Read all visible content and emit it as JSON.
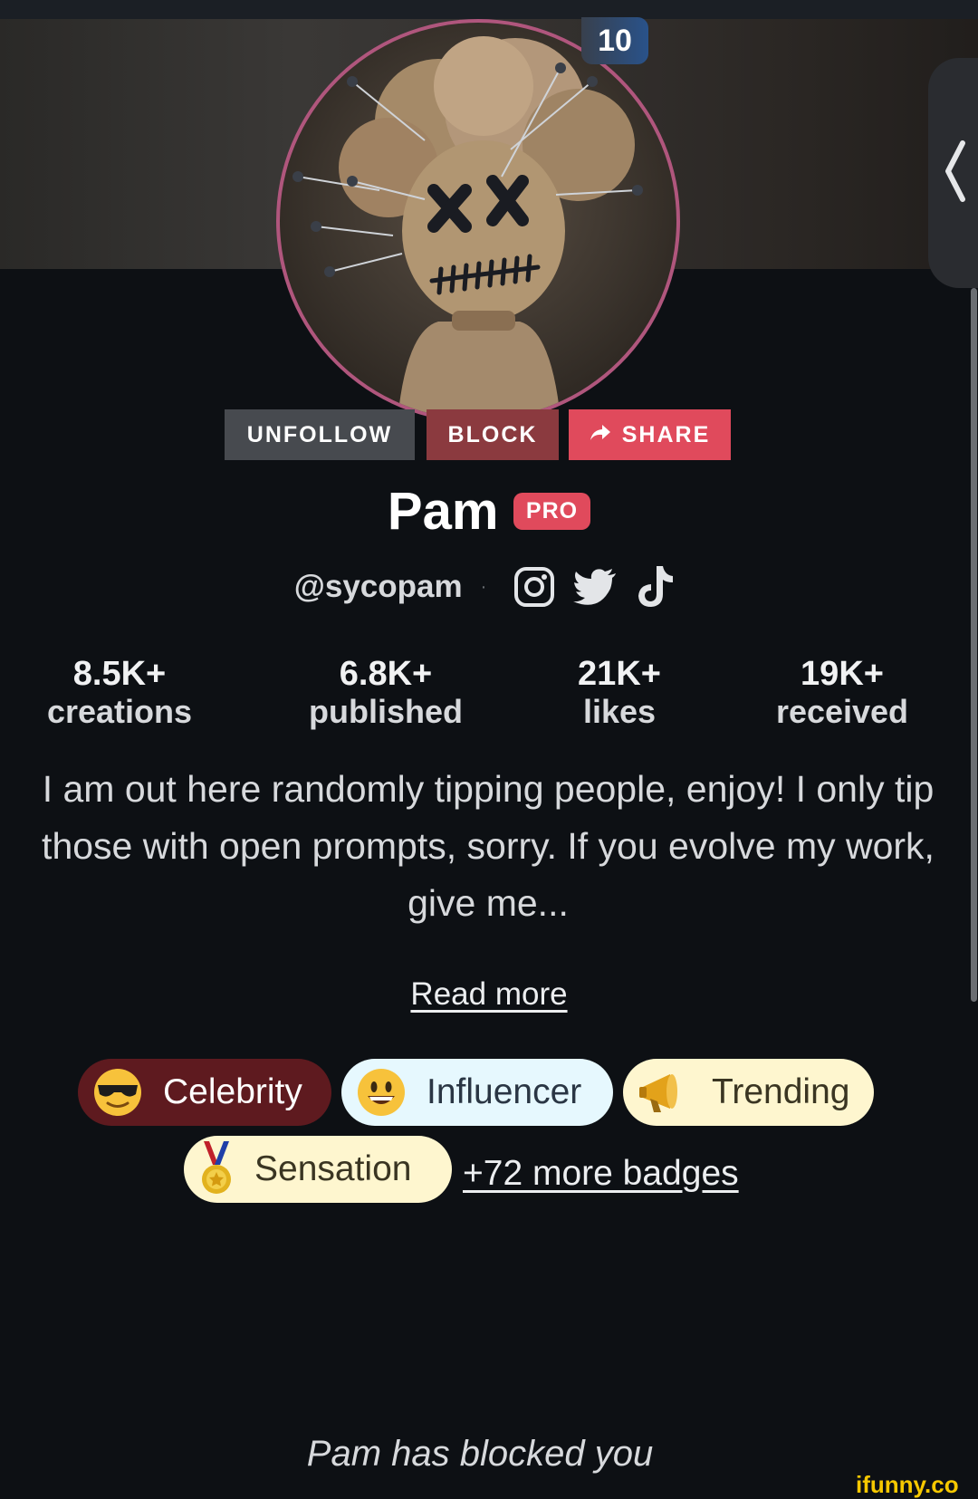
{
  "profile": {
    "level": "10",
    "name": "Pam",
    "pro_label": "PRO",
    "handle": "@sycopam",
    "separator": "·",
    "social_icons": [
      "instagram-icon",
      "twitter-icon",
      "tiktok-icon"
    ]
  },
  "actions": {
    "unfollow_label": "UNFOLLOW",
    "block_label": "BLOCK",
    "share_label": "SHARE"
  },
  "stats": [
    {
      "value": "8.5K+",
      "label": "creations"
    },
    {
      "value": "6.8K+",
      "label": "published"
    },
    {
      "value": "21K+",
      "label": "likes"
    },
    {
      "value": "19K+",
      "label": "received"
    }
  ],
  "bio": {
    "lines": [
      "I am out here randomly tipping people, enjoy! I only tip",
      "those with open prompts, sorry. If you evolve my work,",
      "give me..."
    ],
    "read_more": "Read more"
  },
  "badges": {
    "items": [
      {
        "label": "Celebrity",
        "icon": "sunglasses-emoji-icon",
        "color": "#5e1a1f"
      },
      {
        "label": "Influencer",
        "icon": "grinning-emoji-icon",
        "color": "#e6f8fe"
      },
      {
        "label": "Trending",
        "icon": "megaphone-icon",
        "color": "#fef6cf"
      },
      {
        "label": "Sensation",
        "icon": "medal-icon",
        "color": "#fef6cf"
      }
    ],
    "more_label": "+72 more badges"
  },
  "blocked_message": "Pam has blocked you",
  "watermark": "ifunny.co",
  "colors": {
    "background": "#0d1014",
    "accent": "#e04a5c",
    "block": "#8b3a3f",
    "unfollow": "#474a4f",
    "avatar_ring": "#b0567d"
  }
}
